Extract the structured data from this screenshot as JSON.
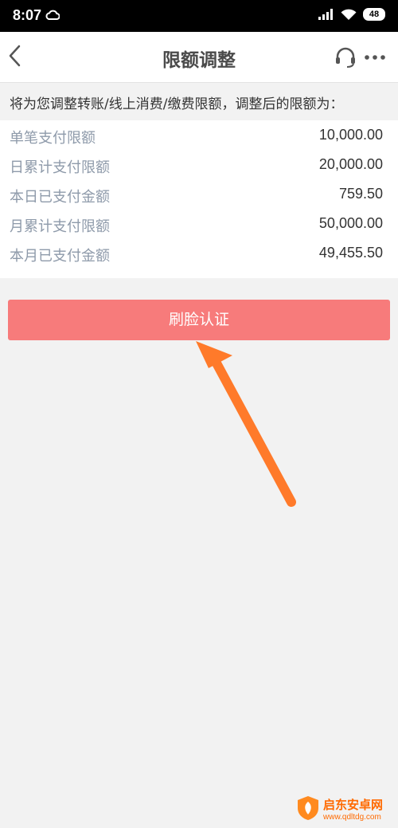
{
  "status_bar": {
    "time": "8:07",
    "battery": "48",
    "icons": [
      "cloud-icon",
      "signal-icon",
      "wifi-icon",
      "battery-icon"
    ]
  },
  "header": {
    "title": "限额调整",
    "back_icon": "chevron-left-icon",
    "support_icon": "headset-icon",
    "more_icon": "more-dots-icon"
  },
  "notice": {
    "text": "将为您调整转账/线上消费/缴费限额，调整后的限额为："
  },
  "limits": [
    {
      "label": "单笔支付限额",
      "value": "10,000.00"
    },
    {
      "label": "日累计支付限额",
      "value": "20,000.00"
    },
    {
      "label": "本日已支付金额",
      "value": "759.50"
    },
    {
      "label": "月累计支付限额",
      "value": "50,000.00"
    },
    {
      "label": "本月已支付金额",
      "value": "49,455.50"
    }
  ],
  "action": {
    "face_auth_label": "刷脸认证"
  },
  "watermark": {
    "title": "启东安卓网",
    "url": "www.qdltdg.com"
  },
  "colors": {
    "button": "#f77b7b",
    "arrow": "#ff7a2a",
    "label": "#8e9aaa",
    "title": "#4a4a4a",
    "background": "#f2f2f2"
  }
}
